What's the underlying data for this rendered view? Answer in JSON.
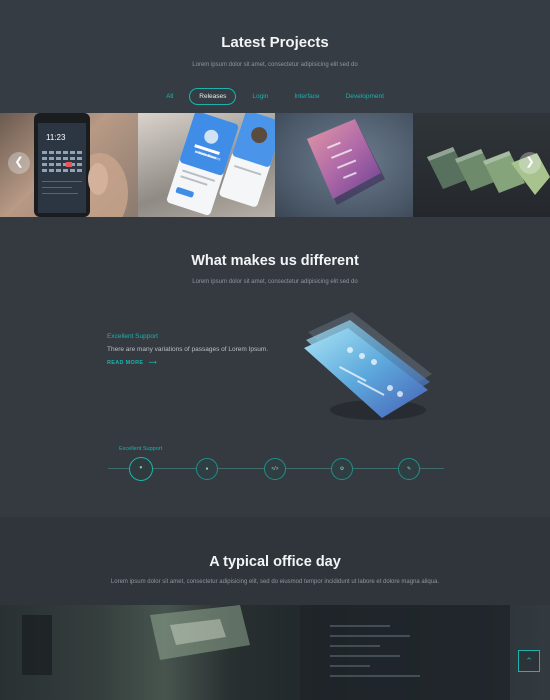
{
  "projects": {
    "title": "Latest Projects",
    "subtitle": "Lorem ipsum dolor sit amet, consectetur adipisicing elit sed do",
    "filters": [
      "All",
      "Releases",
      "Login",
      "Interface",
      "Development"
    ],
    "active_filter": "Releases",
    "gallery": {
      "prev_icon": "chevron-left-icon",
      "next_icon": "chevron-right-icon",
      "phone_time": "11:23",
      "profile_name": "Kate Bowers"
    }
  },
  "different": {
    "title": "What makes us different",
    "subtitle": "Lorem ipsum dolor sit amet, consectetur adipisicing elit sed do",
    "feature": {
      "title": "Excellent Support",
      "text": "There are many variations of passages of Lorem Ipsum.",
      "read_more": "READ MORE"
    },
    "timeline": {
      "active_label": "Excellent Support",
      "steps": [
        "heart-icon",
        "user-icon",
        "code-icon",
        "gear-icon",
        "pencil-icon"
      ],
      "active_index": 0
    }
  },
  "office": {
    "title": "A typical office day",
    "subtitle": "Lorem ipsum dolor sit amet, consectetur adipisicing elit, sed do eiusmod tempor incididunt ut labore et dolore magna aliqua."
  },
  "scroll_top_icon": "chevron-up-icon",
  "colors": {
    "accent": "#1bb3ab",
    "background": "#353b42",
    "muted_text": "#8e969d"
  }
}
